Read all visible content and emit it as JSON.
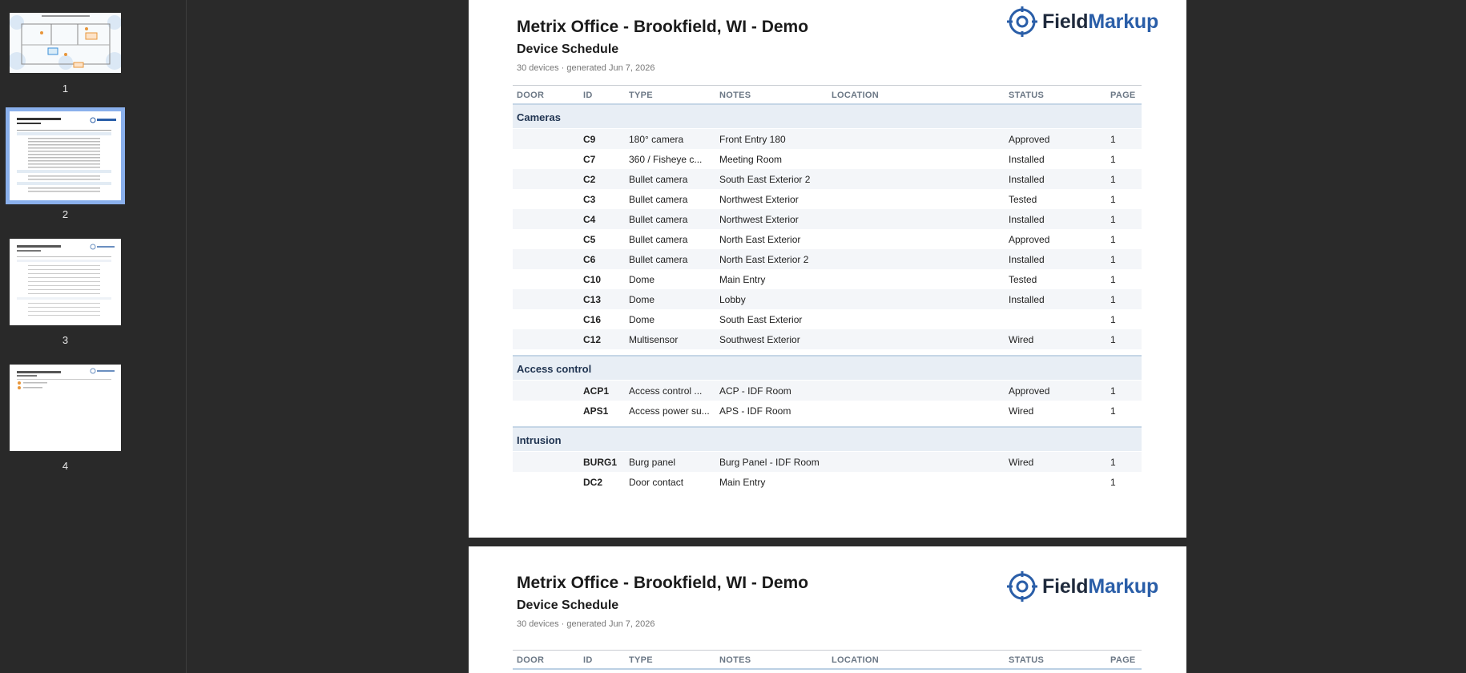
{
  "sidebar": {
    "thumbnails": [
      {
        "label": "1"
      },
      {
        "label": "2"
      },
      {
        "label": "3"
      },
      {
        "label": "4"
      }
    ],
    "selected_index": 1
  },
  "pages": [
    {
      "title": "Metrix Office - Brookfield, WI - Demo",
      "subtitle": "Device Schedule",
      "meta": "30 devices · generated Jun 7, 2026",
      "logo": {
        "part1": "Field",
        "part2": "Markup",
        "icon": "crosshair-target-icon"
      },
      "columns": [
        "DOOR",
        "ID",
        "TYPE",
        "NOTES",
        "LOCATION",
        "STATUS",
        "PAGE"
      ],
      "groups": [
        {
          "name": "Cameras",
          "rows": [
            {
              "door": "",
              "id": "C9",
              "type": "180° camera",
              "notes": "Front Entry 180",
              "location": "",
              "status": "Approved",
              "page": "1"
            },
            {
              "door": "",
              "id": "C7",
              "type": "360 / Fisheye c...",
              "notes": "Meeting Room",
              "location": "",
              "status": "Installed",
              "page": "1"
            },
            {
              "door": "",
              "id": "C2",
              "type": "Bullet camera",
              "notes": "South East Exterior 2",
              "location": "",
              "status": "Installed",
              "page": "1"
            },
            {
              "door": "",
              "id": "C3",
              "type": "Bullet camera",
              "notes": "Northwest Exterior",
              "location": "",
              "status": "Tested",
              "page": "1"
            },
            {
              "door": "",
              "id": "C4",
              "type": "Bullet camera",
              "notes": "Northwest Exterior",
              "location": "",
              "status": "Installed",
              "page": "1"
            },
            {
              "door": "",
              "id": "C5",
              "type": "Bullet camera",
              "notes": "North East Exterior",
              "location": "",
              "status": "Approved",
              "page": "1"
            },
            {
              "door": "",
              "id": "C6",
              "type": "Bullet camera",
              "notes": "North East Exterior 2",
              "location": "",
              "status": "Installed",
              "page": "1"
            },
            {
              "door": "",
              "id": "C10",
              "type": "Dome",
              "notes": "Main Entry",
              "location": "",
              "status": "Tested",
              "page": "1"
            },
            {
              "door": "",
              "id": "C13",
              "type": "Dome",
              "notes": "Lobby",
              "location": "",
              "status": "Installed",
              "page": "1"
            },
            {
              "door": "",
              "id": "C16",
              "type": "Dome",
              "notes": "South East Exterior",
              "location": "",
              "status": "",
              "page": "1"
            },
            {
              "door": "",
              "id": "C12",
              "type": "Multisensor",
              "notes": "Southwest Exterior",
              "location": "",
              "status": "Wired",
              "page": "1"
            }
          ]
        },
        {
          "name": "Access control",
          "rows": [
            {
              "door": "",
              "id": "ACP1",
              "type": "Access control ...",
              "notes": "ACP - IDF Room",
              "location": "",
              "status": "Approved",
              "page": "1"
            },
            {
              "door": "",
              "id": "APS1",
              "type": "Access power su...",
              "notes": "APS - IDF Room",
              "location": "",
              "status": "Wired",
              "page": "1"
            }
          ]
        },
        {
          "name": "Intrusion",
          "rows": [
            {
              "door": "",
              "id": "BURG1",
              "type": "Burg panel",
              "notes": "Burg Panel - IDF Room",
              "location": "",
              "status": "Wired",
              "page": "1"
            },
            {
              "door": "",
              "id": "DC2",
              "type": "Door contact",
              "notes": "Main Entry",
              "location": "",
              "status": "",
              "page": "1"
            }
          ]
        }
      ]
    },
    {
      "title": "Metrix Office - Brookfield, WI - Demo",
      "subtitle": "Device Schedule",
      "meta": "30 devices · generated Jun 7, 2026",
      "logo": {
        "part1": "Field",
        "part2": "Markup",
        "icon": "crosshair-target-icon"
      },
      "columns": [
        "DOOR",
        "ID",
        "TYPE",
        "NOTES",
        "LOCATION",
        "STATUS",
        "PAGE"
      ]
    }
  ],
  "colors": {
    "accent": "#2a5ea8",
    "selection": "#8ab0ec",
    "group_bg": "#e8eef5",
    "dark_bg": "#2a2a2a"
  }
}
